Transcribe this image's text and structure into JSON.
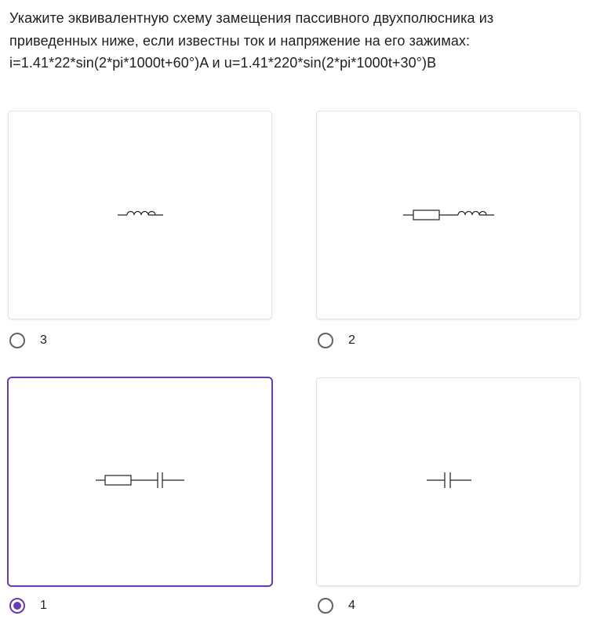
{
  "question": {
    "lines": [
      "Укажите эквивалентную схему замещения пассивного двухполюсника из",
      "приведенных ниже, если известны ток и напряжение на его зажимах:",
      "i=1.41*22*sin(2*pi*1000t+60°)A и u=1.41*220*sin(2*pi*1000t+30°)В"
    ]
  },
  "options": [
    {
      "label": "3",
      "circuit": "inductor",
      "selected": false
    },
    {
      "label": "2",
      "circuit": "resistor-inductor",
      "selected": false
    },
    {
      "label": "1",
      "circuit": "resistor-capacitor",
      "selected": true
    },
    {
      "label": "4",
      "circuit": "capacitor",
      "selected": false
    }
  ],
  "colors": {
    "accent": "#673ab7",
    "radio_border": "#5f6368",
    "text": "#202124",
    "card_border": "#e3e3e3"
  }
}
